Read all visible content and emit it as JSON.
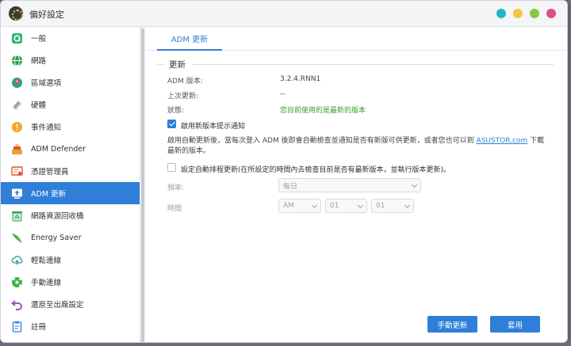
{
  "window": {
    "title": "偏好設定",
    "controls": [
      {
        "name": "help",
        "color": "#1fb7c4"
      },
      {
        "name": "minimize",
        "color": "#f5c542"
      },
      {
        "name": "maximize",
        "color": "#8cc63f"
      },
      {
        "name": "close",
        "color": "#e14b8a"
      }
    ]
  },
  "sidebar": {
    "items": [
      {
        "label": "一般",
        "icon": "general-icon",
        "color": "#2bb673"
      },
      {
        "label": "網路",
        "icon": "globe-icon",
        "color": "#2f9e44"
      },
      {
        "label": "區域選項",
        "icon": "region-icon",
        "color": "#2aa198"
      },
      {
        "label": "硬體",
        "icon": "hardware-icon",
        "color": "#8e9aa6"
      },
      {
        "label": "事件通知",
        "icon": "alert-icon",
        "color": "#f5a623"
      },
      {
        "label": "ADM Defender",
        "icon": "defender-icon",
        "color": "#e8a13a"
      },
      {
        "label": "憑證管理員",
        "icon": "certificate-icon",
        "color": "#e0523f"
      },
      {
        "label": "ADM 更新",
        "icon": "update-icon",
        "color": "#2f7fd8",
        "active": true
      },
      {
        "label": "網路資源回收桶",
        "icon": "recycle-bin-icon",
        "color": "#34a853"
      },
      {
        "label": "Energy Saver",
        "icon": "energy-icon",
        "color": "#2f9e44"
      },
      {
        "label": "輕鬆連線",
        "icon": "cloud-icon",
        "color": "#2aa198"
      },
      {
        "label": "手動連線",
        "icon": "connect-icon",
        "color": "#3cb44b"
      },
      {
        "label": "還原至出廠設定",
        "icon": "restore-icon",
        "color": "#9b59b6"
      },
      {
        "label": "註冊",
        "icon": "register-icon",
        "color": "#2f7fd8"
      }
    ]
  },
  "main": {
    "tab": "ADM 更新",
    "section_title": "更新",
    "fields": [
      {
        "label": "ADM 版本:",
        "value": "3.2.4.RNN1"
      },
      {
        "label": "上次更新:",
        "value": "--"
      },
      {
        "label": "狀態:",
        "value": "您目前使用的是最新的版本"
      }
    ],
    "notify_checkbox": {
      "label": "啟用新版本提示通知",
      "checked": true
    },
    "note_prefix": "啟用自動更新後，當每次登入 ADM 後即會自動檢查並通知是否有新版可供更新，或者您也可以到",
    "note_link": "ASUSTOR.com",
    "note_suffix": "下載最新的版本。",
    "auto_checkbox": {
      "label": "設定自動排程更新(在所設定的時間內去檢查目前是否有最新版本，並執行版本更新)。",
      "checked": false
    },
    "frequency": {
      "label": "頻率:",
      "value": "每日"
    },
    "time": {
      "label": "時間",
      "ampm": "AM",
      "hour": "01",
      "minute": "01"
    },
    "buttons": {
      "manual_update": "手動更新",
      "apply": "套用"
    }
  },
  "colors": {
    "accent": "#2f7fd8",
    "status_ok": "#3d9b2e"
  }
}
